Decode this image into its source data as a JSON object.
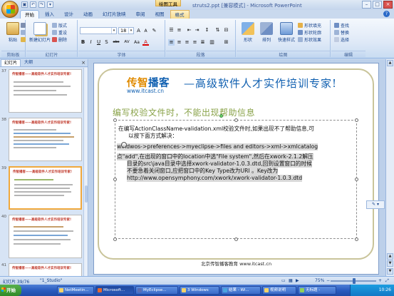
{
  "titlebar": {
    "title": "struts2.ppt [兼容模式] - Microsoft PowerPoint",
    "context_tab": "绘图工具",
    "qat": [
      "▣",
      "↶",
      "↷",
      "▾"
    ],
    "controls": {
      "minimize": "–",
      "maximize": "□",
      "close": "×"
    }
  },
  "ribbon_tabs": [
    "开始",
    "插入",
    "设计",
    "动画",
    "幻灯片放映",
    "审阅",
    "视图",
    "格式"
  ],
  "ribbon": {
    "clipboard": {
      "paste": "粘贴",
      "label": "剪贴板",
      "cut_icon": "scissors-icon"
    },
    "slides": {
      "new_slide": "新建幻灯片",
      "layout": "版式",
      "reset": "重设",
      "delete": "删除",
      "label": "幻灯片"
    },
    "font": {
      "font_name": "",
      "font_size": "18",
      "label": "字体",
      "buttons": [
        "B",
        "I",
        "U",
        "S",
        "abc",
        "AV",
        "Aa",
        "A"
      ]
    },
    "paragraph": {
      "label": "段落"
    },
    "drawing": {
      "shapes": "形状",
      "arrange": "排列",
      "quick_styles": "快速样式",
      "fill": "形状填充",
      "outline": "形状轮廓",
      "effects": "形状效果",
      "label": "绘图"
    },
    "editing": {
      "find": "查找",
      "replace": "替换",
      "select": "选择",
      "label": "编辑"
    }
  },
  "leftpane": {
    "tabs": [
      "幻灯片",
      "大纲"
    ],
    "close": "×",
    "thumbs": [
      {
        "num": "37",
        "title": "传智播客——高级软件人才实作培训专家!"
      },
      {
        "num": "38",
        "title": "传智播客——高级软件人才实作培训专家!"
      },
      {
        "num": "39",
        "title": "传智播客——高级软件人才实作培训专家!"
      },
      {
        "num": "40",
        "title": "传智播客——高级软件人才实作培训专家!"
      },
      {
        "num": "41",
        "title": "传智播客——高级软件人才实作培训专家!"
      }
    ]
  },
  "slide": {
    "logo_part1": "传智",
    "logo_part2": "播客",
    "logo_url": "www.itcast.cn",
    "tagline": "—高级软件人才实作培训专家!",
    "title": "编写校验文件时，不能出现帮助信息",
    "lines": [
      "在编写ActionClassName-validation.xml校验文件时,如果出现不了帮助信息,可",
      "以按下面方式解决：",
      "windwos->preferences->myeclipse->files and editors->xml->xmlcatalog",
      "点\"add\",在出现的窗口中的location中选\"File system\",然后在xwork-2.1.2解压",
      "目录的src\\java目录中选择xwork-validator-1.0.3.dtd,回到设置窗口的时候",
      "不要急着关闭窗口,应把窗口中的Key Type改为URI 。Key改为",
      "http://www.opensymphony.com/xwork/xwork-validator-1.0.3.dtd"
    ],
    "footer": "北京传智播客教育 www.itcast.cn"
  },
  "statusbar": {
    "slide_info": "幻灯片 39/76",
    "theme": "\"1_Studio\"",
    "zoom": "75%",
    "zoom_minus": "−",
    "zoom_plus": "+"
  },
  "taskbar": {
    "start": "开始",
    "items": [
      "NetMeetin...",
      "Microsoft...",
      "MyEclipse...",
      "3 Windows",
      "结果 - Wi...",
      "视频说明",
      "无标题 -"
    ],
    "clock": "10:26"
  }
}
